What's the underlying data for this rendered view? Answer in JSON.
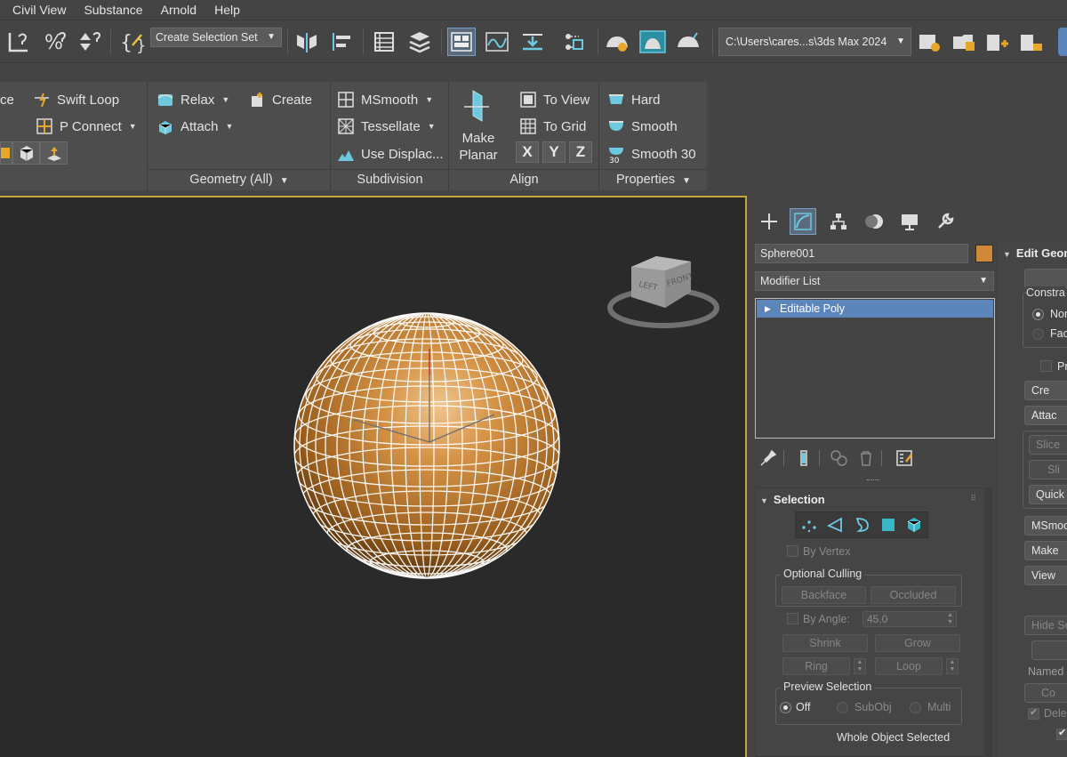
{
  "menu": [
    "Civil View",
    "Substance",
    "Arnold",
    "Help"
  ],
  "toolbar": {
    "selection_set": "Create Selection Set",
    "project_path": "C:\\Users\\cares...s\\3ds Max 2024"
  },
  "ribbon": {
    "panel1": {
      "swift_loop": "Swift Loop",
      "p_connect": "P Connect",
      "left_label": "ce"
    },
    "geometry": {
      "relax": "Relax",
      "create": "Create",
      "attach": "Attach",
      "footer": "Geometry (All)"
    },
    "subdivision": {
      "msmooth": "MSmooth",
      "tessellate": "Tessellate",
      "use_displace": "Use Displac...",
      "footer": "Subdivision"
    },
    "align": {
      "make_planar_1": "Make",
      "make_planar_2": "Planar",
      "to_view": "To View",
      "to_grid": "To Grid",
      "x": "X",
      "y": "Y",
      "z": "Z",
      "footer": "Align"
    },
    "properties": {
      "hard": "Hard",
      "smooth": "Smooth",
      "smooth30": "Smooth 30",
      "footer": "Properties"
    }
  },
  "command_panel": {
    "object_name": "Sphere001",
    "object_color": "#d08838",
    "modifier_list": "Modifier List",
    "stack": [
      "Editable Poly"
    ],
    "selection": {
      "title": "Selection",
      "by_vertex": "By Vertex",
      "optional_culling": "Optional Culling",
      "backface": "Backface",
      "occluded": "Occluded",
      "by_angle": "By Angle:",
      "angle_value": "45.0",
      "shrink": "Shrink",
      "grow": "Grow",
      "ring": "Ring",
      "loop": "Loop",
      "preview_selection": "Preview Selection",
      "off": "Off",
      "subobj": "SubObj",
      "multi": "Multi",
      "status": "Whole Object Selected"
    },
    "edit_geometry": {
      "title": "Edit Geom",
      "constraints": "Constra",
      "none": "Non",
      "face": "Fac",
      "preserve": "Pr",
      "create": "Cre",
      "attach": "Attac",
      "slice_plane": "Slice",
      "slice": "Sli",
      "quickslice": "Quick",
      "msmooth": "MSmoo",
      "make_planar": "Make",
      "view_align": "View",
      "hide_selected": "Hide Se",
      "named_selections": "Named",
      "copy": "Co",
      "delete_isolated": "Dele"
    }
  },
  "viewcube": {
    "left": "LEFT",
    "front": "FRONT"
  },
  "colors": {
    "accent_active": "#5c86bb",
    "viewport_border": "#c9a63c",
    "sphere": "#c9802f"
  }
}
